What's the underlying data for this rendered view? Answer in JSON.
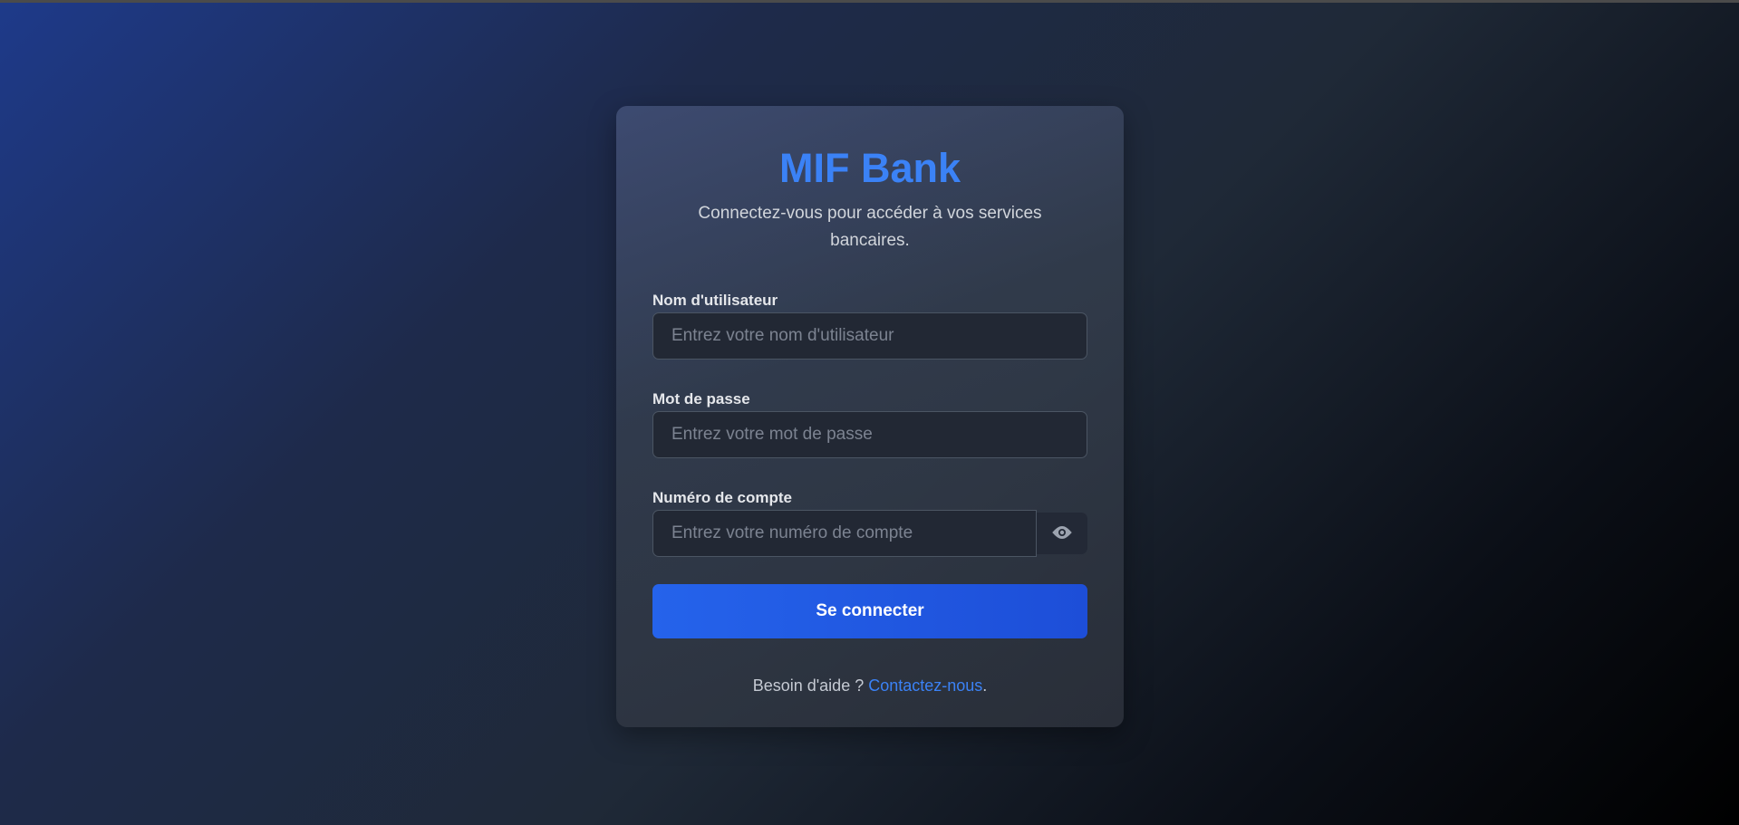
{
  "brand": {
    "title": "MIF Bank",
    "subtitle": "Connectez-vous pour accéder à vos services bancaires."
  },
  "form": {
    "username": {
      "label": "Nom d'utilisateur",
      "value": "",
      "placeholder": "Entrez votre nom d'utilisateur"
    },
    "password": {
      "label": "Mot de passe",
      "value": "",
      "placeholder": "Entrez votre mot de passe"
    },
    "account": {
      "label": "Numéro de compte",
      "value": "",
      "placeholder": "Entrez votre numéro de compte",
      "toggle_icon": "eye-icon"
    },
    "submit_label": "Se connecter"
  },
  "help": {
    "text": "Besoin d'aide ? ",
    "link_label": "Contactez-nous",
    "suffix": "."
  },
  "colors": {
    "accent": "#3b82f6",
    "button": "#2563eb"
  }
}
